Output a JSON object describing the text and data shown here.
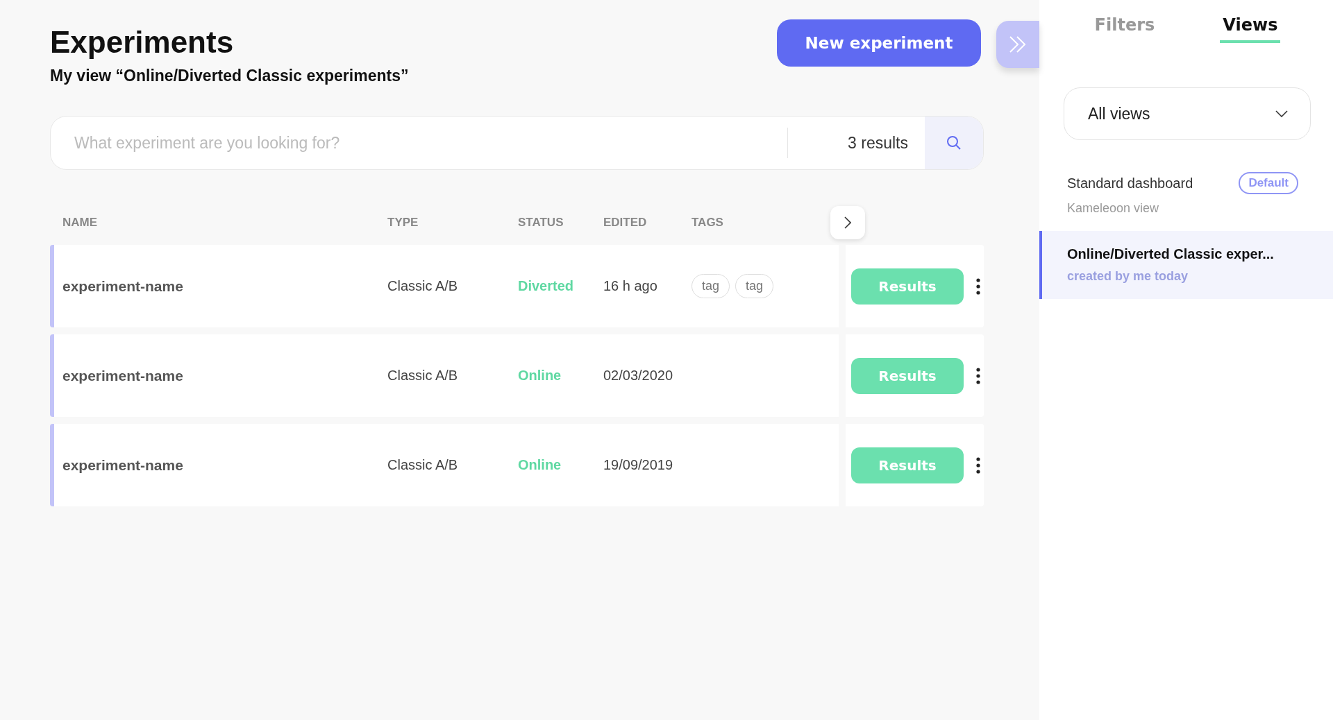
{
  "header": {
    "title": "Experiments",
    "subtitle": "My view “Online/Diverted Classic experiments”",
    "new_button": "New experiment"
  },
  "search": {
    "placeholder": "What experiment are you looking for?",
    "results": "3 results"
  },
  "table": {
    "columns": [
      "NAME",
      "TYPE",
      "STATUS",
      "EDITED",
      "TAGS"
    ],
    "rows": [
      {
        "name": "experiment-name",
        "type": "Classic A/B",
        "status": "Diverted",
        "edited": "16 h ago",
        "tags": [
          "tag",
          "tag"
        ],
        "action": "Results"
      },
      {
        "name": "experiment-name",
        "type": "Classic A/B",
        "status": "Online",
        "edited": "02/03/2020",
        "tags": [],
        "action": "Results"
      },
      {
        "name": "experiment-name",
        "type": "Classic A/B",
        "status": "Online",
        "edited": "19/09/2019",
        "tags": [],
        "action": "Results"
      }
    ]
  },
  "sidebar": {
    "tabs": [
      {
        "label": "Filters",
        "selected": false
      },
      {
        "label": "Views",
        "selected": true
      }
    ],
    "dropdown": "All views",
    "views": [
      {
        "title": "Standard dashboard",
        "subtitle": "Kameleoon view",
        "badge": "Default",
        "selected": false
      },
      {
        "title": "Online/Diverted Classic exper...",
        "subtitle": "created by me today",
        "selected": true
      }
    ]
  }
}
